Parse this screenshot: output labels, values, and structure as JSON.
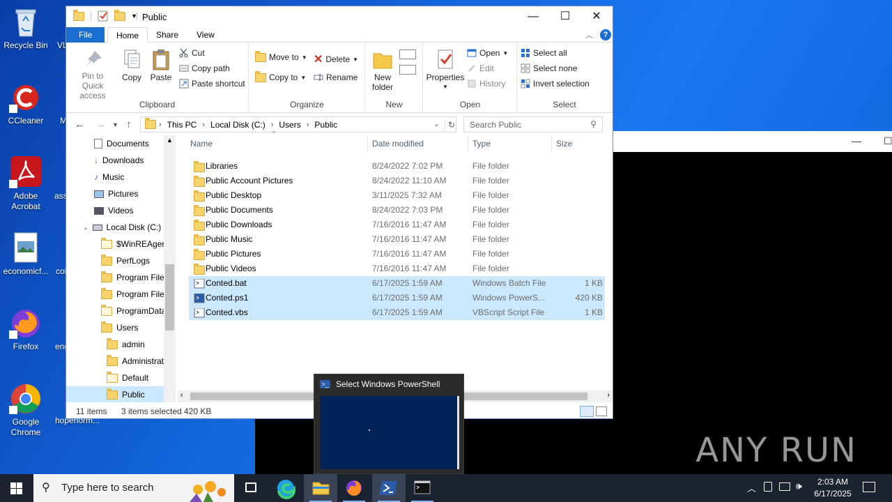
{
  "desktop": {
    "icons": [
      {
        "label": "Recycle Bin"
      },
      {
        "label": "CCleaner"
      },
      {
        "label": "Adobe Acrobat"
      },
      {
        "label": "economicf..."
      },
      {
        "label": "Firefox"
      },
      {
        "label": "Google Chrome"
      },
      {
        "label": "VL"
      },
      {
        "label": "M"
      },
      {
        "label": "ass"
      },
      {
        "label": "col"
      },
      {
        "label": "eng"
      },
      {
        "label": "hopenorm..."
      }
    ],
    "watermark": "ANY RUN"
  },
  "explorer": {
    "title": "Public",
    "tabs": {
      "file": "File",
      "home": "Home",
      "share": "Share",
      "view": "View"
    },
    "ribbon": {
      "clipboard": {
        "name": "Clipboard",
        "pin": "Pin to Quick access",
        "copy": "Copy",
        "paste": "Paste",
        "cut": "Cut",
        "copy_path": "Copy path",
        "paste_shortcut": "Paste shortcut"
      },
      "organize": {
        "name": "Organize",
        "move_to": "Move to",
        "copy_to": "Copy to",
        "delete": "Delete",
        "rename": "Rename"
      },
      "new": {
        "name": "New",
        "new_folder": "New folder"
      },
      "open": {
        "name": "Open",
        "properties": "Properties",
        "open": "Open",
        "edit": "Edit",
        "history": "History"
      },
      "select": {
        "name": "Select",
        "select_all": "Select all",
        "select_none": "Select none",
        "invert": "Invert selection"
      }
    },
    "address": {
      "crumbs": [
        "This PC",
        "Local Disk (C:)",
        "Users",
        "Public"
      ]
    },
    "search_placeholder": "Search Public",
    "nav": [
      {
        "label": "Documents"
      },
      {
        "label": "Downloads"
      },
      {
        "label": "Music"
      },
      {
        "label": "Pictures"
      },
      {
        "label": "Videos"
      },
      {
        "label": "Local Disk (C:)"
      },
      {
        "label": "$WinREAgent"
      },
      {
        "label": "PerfLogs"
      },
      {
        "label": "Program Files"
      },
      {
        "label": "Program Files"
      },
      {
        "label": "ProgramData"
      },
      {
        "label": "Users"
      },
      {
        "label": "admin"
      },
      {
        "label": "Administrat"
      },
      {
        "label": "Default"
      },
      {
        "label": "Public"
      }
    ],
    "columns": {
      "name": "Name",
      "date": "Date modified",
      "type": "Type",
      "size": "Size"
    },
    "files": [
      {
        "name": "Libraries",
        "date": "8/24/2022 7:02 PM",
        "type": "File folder",
        "size": ""
      },
      {
        "name": "Public Account Pictures",
        "date": "8/24/2022 11:10 AM",
        "type": "File folder",
        "size": ""
      },
      {
        "name": "Public Desktop",
        "date": "3/11/2025 7:32 AM",
        "type": "File folder",
        "size": ""
      },
      {
        "name": "Public Documents",
        "date": "8/24/2022 7:03 PM",
        "type": "File folder",
        "size": ""
      },
      {
        "name": "Public Downloads",
        "date": "7/16/2016 11:47 AM",
        "type": "File folder",
        "size": ""
      },
      {
        "name": "Public Music",
        "date": "7/16/2016 11:47 AM",
        "type": "File folder",
        "size": ""
      },
      {
        "name": "Public Pictures",
        "date": "7/16/2016 11:47 AM",
        "type": "File folder",
        "size": ""
      },
      {
        "name": "Public Videos",
        "date": "7/16/2016 11:47 AM",
        "type": "File folder",
        "size": ""
      },
      {
        "name": "Conted.bat",
        "date": "6/17/2025 1:59 AM",
        "type": "Windows Batch File",
        "size": "1 KB"
      },
      {
        "name": "Conted.ps1",
        "date": "6/17/2025 1:59 AM",
        "type": "Windows PowerS...",
        "size": "420 KB"
      },
      {
        "name": "Conted.vbs",
        "date": "6/17/2025 1:59 AM",
        "type": "VBScript Script File",
        "size": "1 KB"
      }
    ],
    "status": {
      "count": "11 items",
      "selected": "3 items selected",
      "size": "420 KB"
    }
  },
  "thumbnail": {
    "title": "Select Windows PowerShell"
  },
  "taskbar": {
    "search_placeholder": "Type here to search",
    "time": "2:03 AM",
    "date": "6/17/2025"
  },
  "colors": {
    "accent": "#1a6ed1",
    "selection": "#cce8ff",
    "taskbar": "#1b2230",
    "powershell": "#012456"
  }
}
